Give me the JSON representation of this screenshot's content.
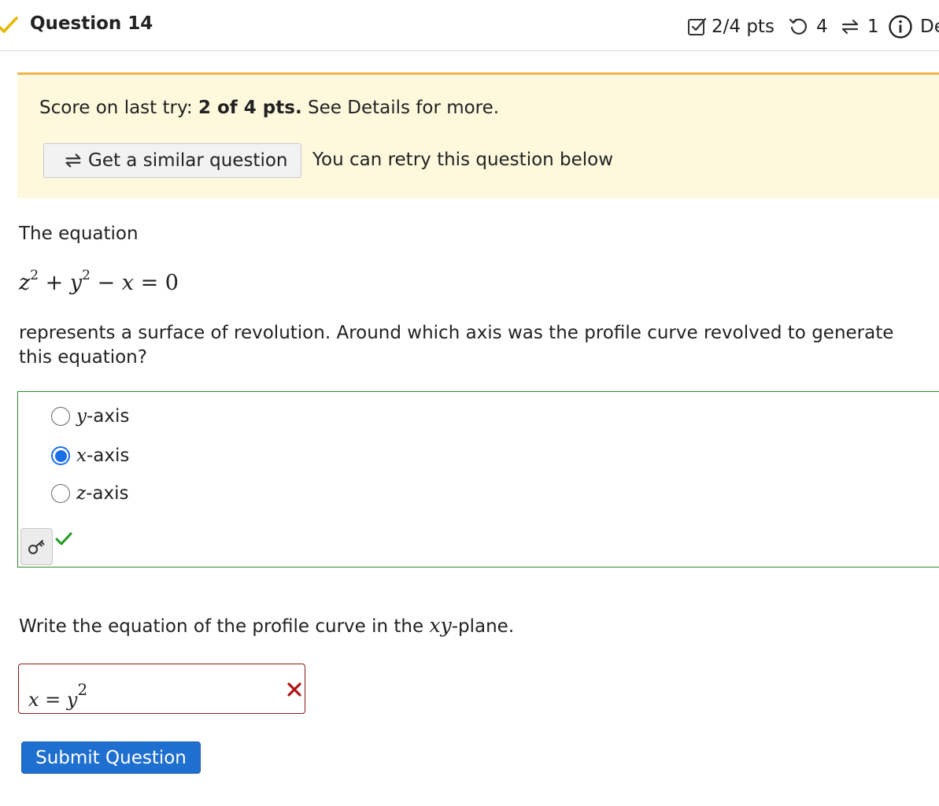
{
  "header": {
    "title": "Question 14",
    "points": "2/4 pts",
    "attempts": "4",
    "similar_count": "1",
    "details_label": "De",
    "icons": {
      "status": "checkmark-icon",
      "points": "checkbox-icon",
      "attempts": "retry-icon",
      "similar": "repeat-icon",
      "details": "info-icon"
    }
  },
  "banner": {
    "score_prefix": "Score on last try:",
    "score_value": "2 of 4 pts.",
    "score_suffix": "See Details for more.",
    "similar_button": "Get a similar question",
    "retry_text": "You can retry this question below"
  },
  "question": {
    "intro": "The equation",
    "equation": {
      "t1": "z",
      "exp1": "2",
      "op1": " + ",
      "t2": "y",
      "exp2": "2",
      "op2": " − ",
      "t3": "x",
      "op3": " = ",
      "rhs": "0"
    },
    "body": "represents a surface of revolution. Around which axis was the profile curve revolved to generate this equation?",
    "choices": [
      {
        "var": "y",
        "label": "-axis",
        "selected": false
      },
      {
        "var": "x",
        "label": "-axis",
        "selected": true
      },
      {
        "var": "z",
        "label": "-axis",
        "selected": false
      }
    ]
  },
  "part2": {
    "prompt_prefix": "Write the equation of the profile curve in the ",
    "prompt_math": "xy",
    "prompt_suffix": "-plane.",
    "answer": {
      "lhs": "x",
      "eq": " = ",
      "rhs": "y",
      "exp": "2"
    }
  },
  "submit_label": "Submit Question",
  "colors": {
    "banner_bg": "#fef9dd",
    "banner_border": "#f0b44a",
    "correct": "#2e8b2e",
    "incorrect": "#8b1a1a",
    "primary": "#1f6fd0"
  }
}
